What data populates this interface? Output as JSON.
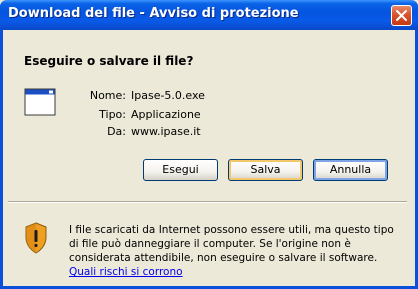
{
  "window": {
    "title": "Download del file - Avviso di protezione"
  },
  "dialog": {
    "question": "Eseguire o salvare il file?",
    "file": {
      "name_label": "Nome:",
      "name_value": "Ipase-5.0.exe",
      "type_label": "Tipo:",
      "type_value": "Applicazione",
      "from_label": "Da:",
      "from_value": "www.ipase.it"
    },
    "buttons": {
      "run": "Esegui",
      "save": "Salva",
      "cancel": "Annulla"
    },
    "warning": {
      "text": "I file scaricati da Internet possono essere utili, ma questo tipo di file può danneggiare il computer. Se l'origine non è considerata attendibile, non eseguire o salvare il software.",
      "link": "Quali rischi si corrono"
    }
  },
  "colors": {
    "titlebar": "#0a5ae8",
    "dialog_bg": "#ece9d8",
    "close_button": "#d9532c",
    "link": "#0000ee",
    "default_button_highlight": "#f5c76b"
  },
  "icons": [
    "close-icon",
    "application-window-icon",
    "security-shield-warning-icon"
  ]
}
